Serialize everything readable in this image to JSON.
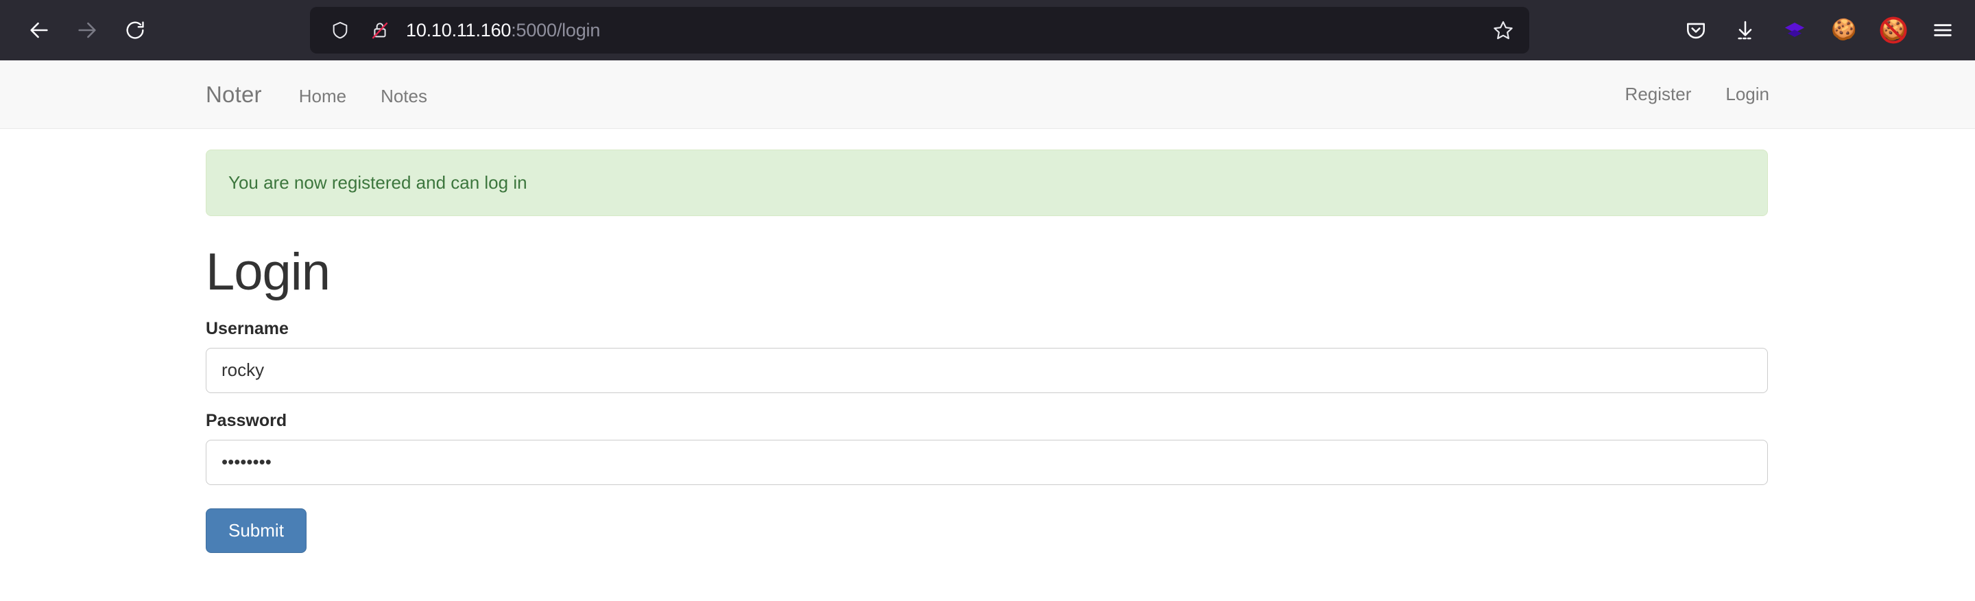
{
  "browser": {
    "back_label": "Back",
    "forward_label": "Forward",
    "reload_label": "Reload",
    "url_host": "10.10.11.160",
    "url_rest": ":5000/login",
    "shield_label": "Tracking protection",
    "lock_label": "Connection is not secure",
    "bookmark_label": "Bookmark this page",
    "toolbar_icons": [
      {
        "name": "pocket-icon",
        "glyph": ""
      },
      {
        "name": "downloads-icon",
        "glyph": ""
      },
      {
        "name": "layers-extension-icon",
        "glyph": ""
      },
      {
        "name": "cookie-extension-icon",
        "glyph": "🍪"
      },
      {
        "name": "cookie-blocked-extension-icon",
        "glyph": "🍪"
      },
      {
        "name": "app-menu-icon",
        "glyph": ""
      }
    ]
  },
  "navbar": {
    "brand": "Noter",
    "left_links": [
      {
        "label": "Home"
      },
      {
        "label": "Notes"
      }
    ],
    "right_links": [
      {
        "label": "Register"
      },
      {
        "label": "Login"
      }
    ]
  },
  "alert": {
    "message": "You are now registered and can log in",
    "bg_color": "#dff0d8",
    "text_color": "#3c763d"
  },
  "form": {
    "title": "Login",
    "username": {
      "label": "Username",
      "value": "rocky",
      "placeholder": ""
    },
    "password": {
      "label": "Password",
      "value": "••••••••",
      "placeholder": ""
    },
    "submit_label": "Submit",
    "submit_color": "#4a7fb5"
  }
}
